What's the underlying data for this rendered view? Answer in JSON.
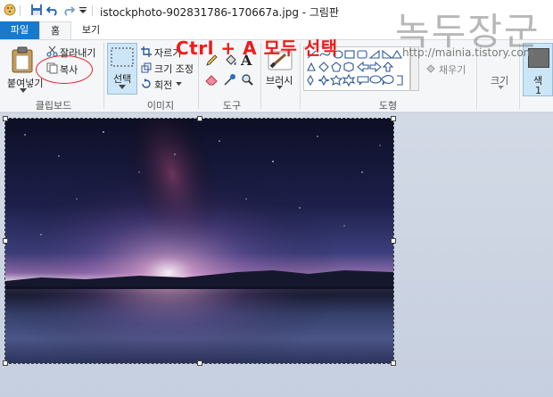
{
  "window": {
    "title": "istockphoto-902831786-170667a.jpg - 그림판"
  },
  "tabs": [
    {
      "label": "파일"
    },
    {
      "label": "홈"
    },
    {
      "label": "보기"
    }
  ],
  "clipboard": {
    "paste_label": "붙여넣기",
    "cut_label": "잘라내기",
    "copy_label": "복사",
    "group_label": "클립보드"
  },
  "image_group": {
    "select_label": "선택",
    "crop_label": "자르기",
    "resize_label": "크기 조정",
    "rotate_label": "회전",
    "group_label": "이미지"
  },
  "tools": {
    "group_label": "도구"
  },
  "brushes": {
    "label": "브러시"
  },
  "shapes": {
    "fill_label": "채우기",
    "group_label": "도형"
  },
  "size": {
    "label": "크기"
  },
  "color": {
    "label": "색",
    "index": "1"
  },
  "annotation": {
    "text": "Ctrl + A 모두 선택",
    "color": "#ef1b1b"
  },
  "watermark": {
    "text": "녹두장군",
    "url": "http://mainia.tistory.com"
  },
  "colors": {
    "file_tab": "#1979ca",
    "ribbon_bg": "#f5f6f7",
    "canvas_bg": "#c7d0df",
    "selected_color": "#6e6e6e"
  }
}
